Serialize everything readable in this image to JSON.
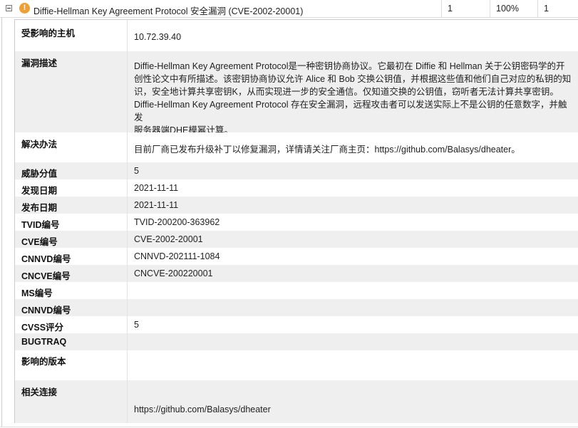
{
  "header": {
    "title": "Diffie-Hellman Key Agreement Protocol 安全漏洞 (CVE-2002-20001)",
    "col_count": "1",
    "col_percent": "100%",
    "col_hosts": "1"
  },
  "details": {
    "affected_host_label": "受影响的主机",
    "affected_host": "10.72.39.40",
    "description_label": "漏洞描述",
    "description_lines": [
      "Diffie-Hellman Key Agreement Protocol是一种密钥协商协议。它最初在 Diffie 和 Hellman 关于公钥密码学的开",
      "创性论文中有所描述。该密钥协商协议允许 Alice 和 Bob 交换公钥值，并根据这些值和他们自己对应的私钥的知",
      "识，安全地计算共享密钥K，从而实现进一步的安全通信。仅知道交换的公钥值，窃听者无法计算共享密钥。",
      "Diffie-Hellman Key Agreement Protocol 存在安全漏洞，远程攻击者可以发送实际上不是公钥的任意数字，并触发",
      "服务器端DHE模幂计算。"
    ],
    "solution_label": "解决办法",
    "solution": "目前厂商已发布升级补丁以修复漏洞，详情请关注厂商主页：https://github.com/Balasys/dheater。",
    "threat_label": "威胁分值",
    "threat": "5",
    "discovered_label": "发现日期",
    "discovered": "2021-11-11",
    "published_label": "发布日期",
    "published": "2021-11-11",
    "tvid_label": "TVID编号",
    "tvid": "TVID-200200-363962",
    "cve_label": "CVE编号",
    "cve": "CVE-2002-20001",
    "cnnvd_label": "CNNVD编号",
    "cnnvd": "CNNVD-202111-1084",
    "cncve_label": "CNCVE编号",
    "cncve": "CNCVE-200220001",
    "ms_label": "MS编号",
    "ms": "",
    "cnnvd2_label": "CNNVD编号",
    "cnnvd2": "",
    "cvss_label": "CVSS评分",
    "cvss": "5",
    "bugtraq_label": "BUGTRAQ",
    "bugtraq": "",
    "affected_version_label": "影响的版本",
    "affected_version": "",
    "related_link_label": "相关连接",
    "related_link": "https://github.com/Balasys/dheater"
  },
  "colors": {
    "row_alt": "#efefef",
    "warn": "#f0a030",
    "border": "#cccccc"
  },
  "icons": [
    "collapse-icon",
    "warning-icon"
  ]
}
